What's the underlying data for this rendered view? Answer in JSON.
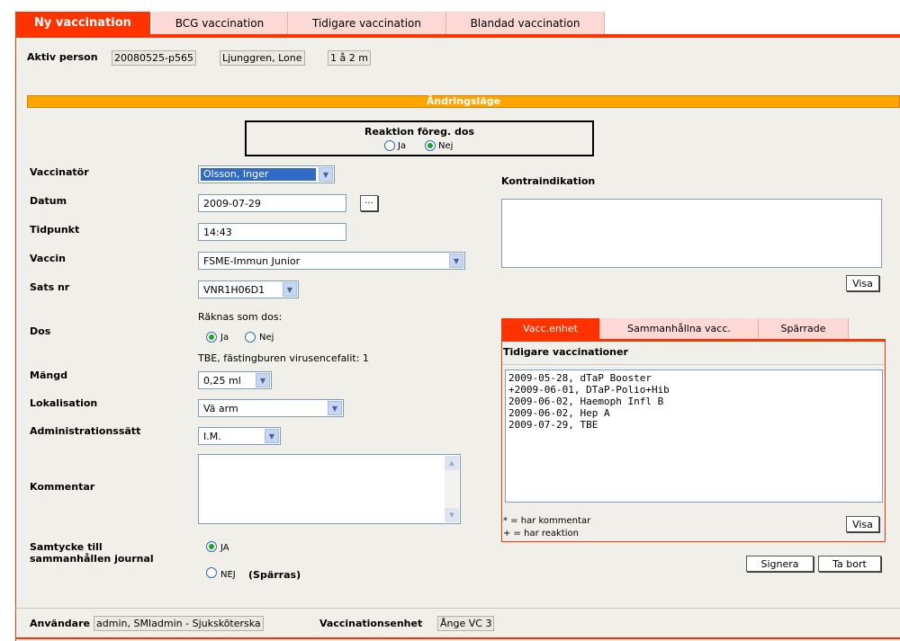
{
  "tabs": [
    {
      "label": "Ny vaccination",
      "active": true
    },
    {
      "label": "BCG vaccination",
      "active": false
    },
    {
      "label": "Tidigare vaccination",
      "active": false
    },
    {
      "label": "Blandad vaccination",
      "active": false
    }
  ],
  "person": {
    "label": "Aktiv person",
    "id": "20080525-p565",
    "name": "Ljunggren, Lone",
    "age": "1 å 2 m"
  },
  "mode_label": "Ändringsläge",
  "reaktion": {
    "title": "Reaktion föreg. dos",
    "yes": "Ja",
    "no": "Nej",
    "selected": "Nej"
  },
  "form": {
    "vaccinator_label": "Vaccinatör",
    "vaccinator_value": "Olsson, Inger",
    "datum_label": "Datum",
    "datum_value": "2009-07-29",
    "datum_button": "...",
    "tidpunkt_label": "Tidpunkt",
    "tidpunkt_value": "14:43",
    "vaccin_label": "Vaccin",
    "vaccin_value": "FSME-Immun Junior",
    "sats_label": "Sats nr",
    "sats_value": "VNR1H06D1",
    "dos_label": "Dos",
    "raknas_label": "Räknas som dos:",
    "dos_yes": "Ja",
    "dos_no": "Nej",
    "dos_selected": "Ja",
    "dos_info": "TBE, fästingburen virusencefalit: 1",
    "mangd_label": "Mängd",
    "mangd_value": "0,25 ml",
    "lokalisation_label": "Lokalisation",
    "lokalisation_value": "Vä arm",
    "admin_label": "Administrationssätt",
    "admin_value": "I.M.",
    "kommentar_label": "Kommentar",
    "samtycke_label_1": "Samtycke till",
    "samtycke_label_2": "sammanhållen journal",
    "samtycke_yes": "JA",
    "samtycke_no": "NEJ",
    "samtycke_no_extra": "(Spärras)",
    "samtycke_selected": "JA"
  },
  "kontraindikation": {
    "label": "Kontraindikation",
    "button": "Visa"
  },
  "history": {
    "tabs": [
      {
        "label": "Vacc.enhet",
        "active": true
      },
      {
        "label": "Sammanhållna vacc.",
        "active": false
      },
      {
        "label": "Spärrade",
        "active": false
      }
    ],
    "title": "Tidigare vaccinationer",
    "items": [
      "2009-05-28, dTaP Booster",
      "+2009-06-01, DTaP-Polio+Hib",
      "2009-06-02, Haemoph Infl B",
      "2009-06-02, Hep A",
      "2009-07-29, TBE"
    ],
    "legend_comment": "* = har kommentar",
    "legend_reaction": "+ = har reaktion",
    "button": "Visa"
  },
  "actions": {
    "sign": "Signera",
    "delete": "Ta bort"
  },
  "footer": {
    "user_label": "Användare",
    "user_value": "admin, SMIadmin - Sjuksköterska",
    "unit_label": "Vaccinationsenhet",
    "unit_value": "Ånge VC 3"
  },
  "colors": {
    "accent": "#ff3300",
    "mode_bar": "#ffa500",
    "panel_bg": "#f0efe9",
    "tab_inactive": "#fcd9d5"
  }
}
